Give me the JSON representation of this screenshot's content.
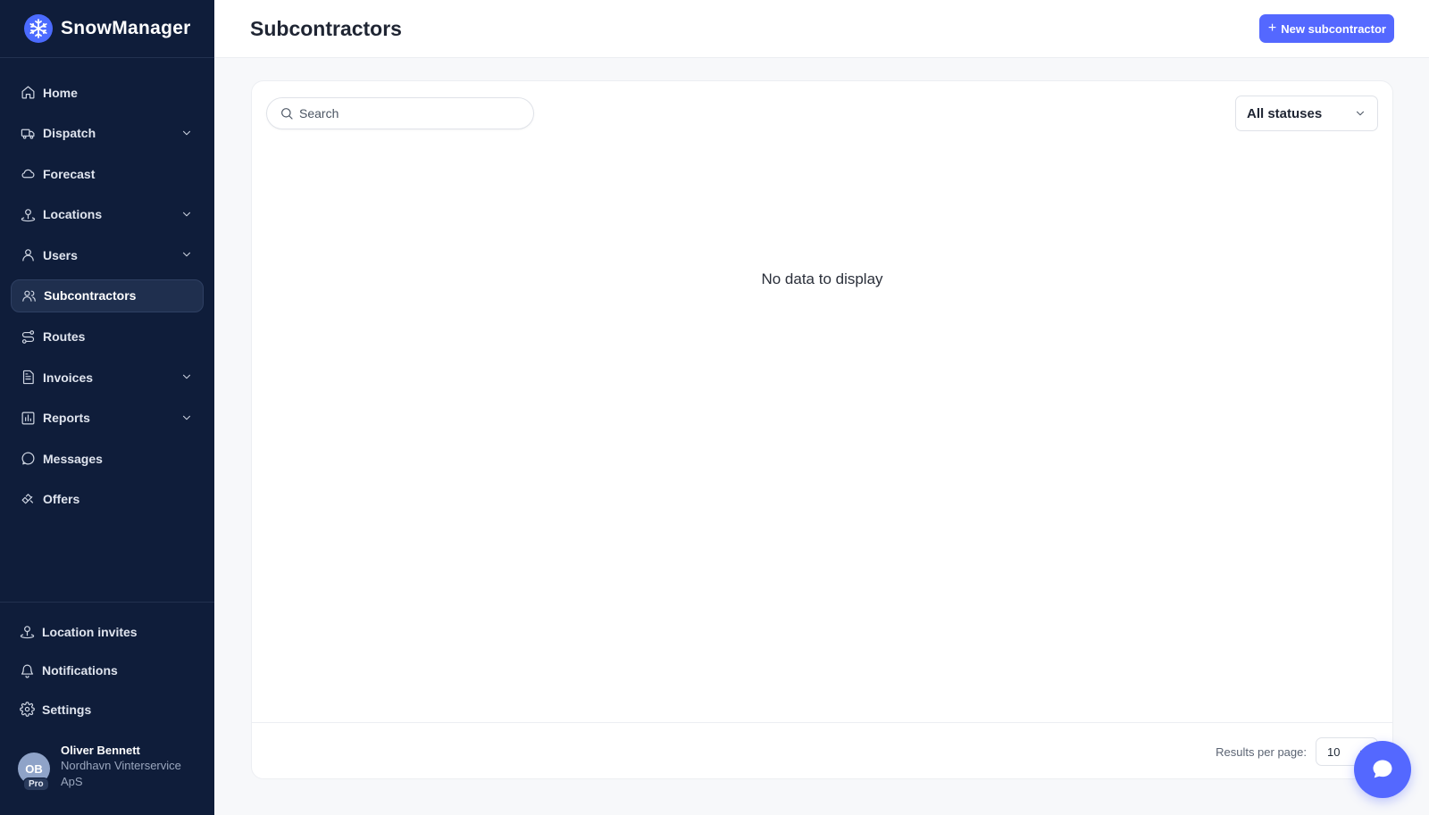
{
  "brand": {
    "name": "SnowManager",
    "logo_icon": "snowflake-icon"
  },
  "sidebar": {
    "items": [
      {
        "label": "Home",
        "icon": "home-icon",
        "expandable": false,
        "active": false
      },
      {
        "label": "Dispatch",
        "icon": "truck-icon",
        "expandable": true,
        "active": false
      },
      {
        "label": "Forecast",
        "icon": "cloud-icon",
        "expandable": false,
        "active": false
      },
      {
        "label": "Locations",
        "icon": "location-pin-icon",
        "expandable": true,
        "active": false
      },
      {
        "label": "Users",
        "icon": "user-icon",
        "expandable": true,
        "active": false
      },
      {
        "label": "Subcontractors",
        "icon": "users-icon",
        "expandable": false,
        "active": true
      },
      {
        "label": "Routes",
        "icon": "route-icon",
        "expandable": false,
        "active": false
      },
      {
        "label": "Invoices",
        "icon": "invoice-icon",
        "expandable": true,
        "active": false
      },
      {
        "label": "Reports",
        "icon": "bar-chart-icon",
        "expandable": true,
        "active": false
      },
      {
        "label": "Messages",
        "icon": "message-icon",
        "expandable": false,
        "active": false
      },
      {
        "label": "Offers",
        "icon": "offer-icon",
        "expandable": false,
        "active": false
      }
    ],
    "bottom_items": [
      {
        "label": "Location invites",
        "icon": "location-pin-icon"
      },
      {
        "label": "Notifications",
        "icon": "bell-icon"
      },
      {
        "label": "Settings",
        "icon": "gear-icon"
      }
    ]
  },
  "user": {
    "initials": "OB",
    "badge": "Pro",
    "name": "Oliver Bennett",
    "organization": "Nordhavn Vinterservice ApS"
  },
  "header": {
    "title": "Subcontractors",
    "new_button_label": "New subcontractor"
  },
  "filters": {
    "search_placeholder": "Search",
    "search_value": "",
    "status_selected": "All statuses"
  },
  "table": {
    "empty_message": "No data to display"
  },
  "pagination": {
    "results_per_page_label": "Results per page:",
    "results_per_page_value": "10"
  },
  "colors": {
    "sidebar_bg": "#0f1d3a",
    "accent": "#5468ff"
  }
}
